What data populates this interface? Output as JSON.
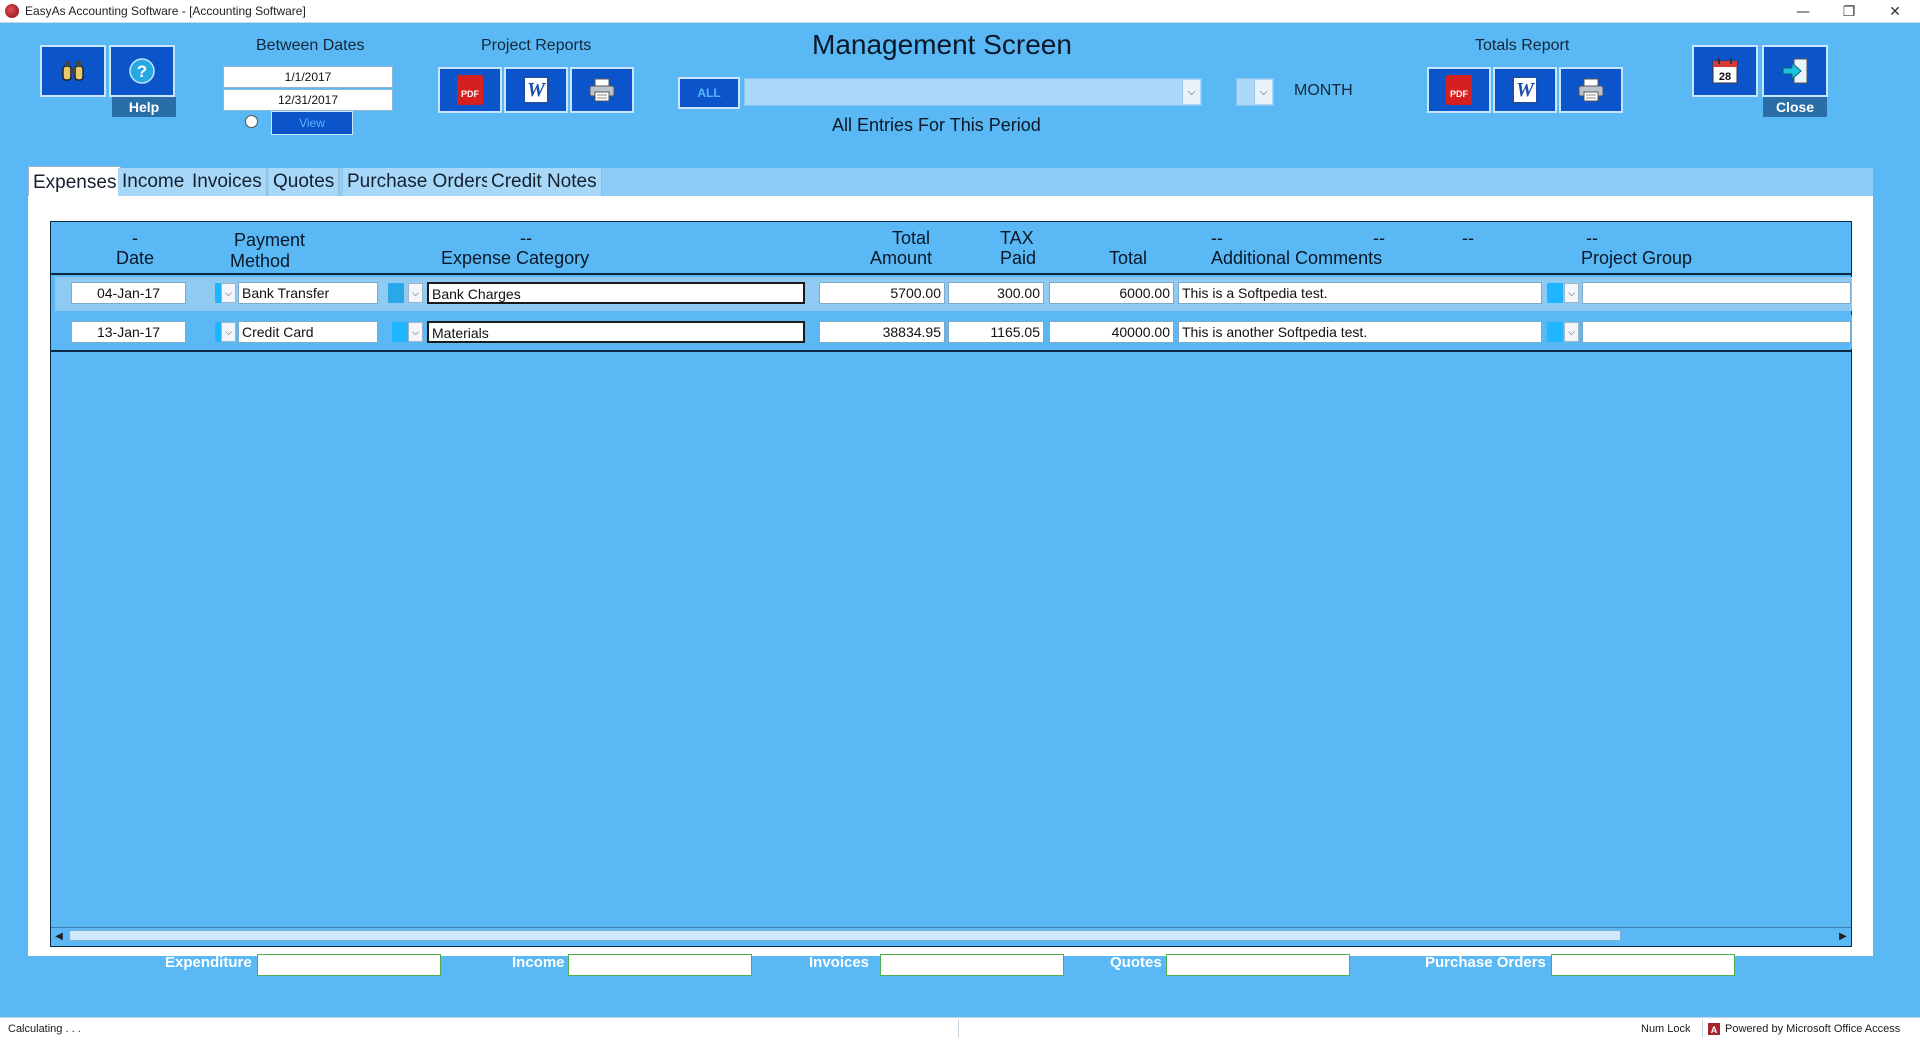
{
  "window": {
    "title": "EasyAs Accounting Software - [Accounting Software]",
    "minimize": "—",
    "restore": "❐",
    "close": "✕"
  },
  "toolbar": {
    "help_label": "Help",
    "close_label": "Close",
    "between_dates_label": "Between Dates",
    "date_from": "1/1/2017",
    "date_to": "12/31/2017",
    "view_label": "View",
    "project_reports_label": "Project Reports",
    "totals_report_label": "Totals Report",
    "all_label": "ALL",
    "period_label": "MONTH",
    "calendar_day": "28",
    "pdf_label": "PDF",
    "word_label": "W"
  },
  "header": {
    "title": "Management Screen",
    "subtitle": "All Entries For This Period"
  },
  "tabs": [
    {
      "label": "Expenses",
      "active": true
    },
    {
      "label": "Income",
      "active": false
    },
    {
      "label": "Invoices",
      "active": false
    },
    {
      "label": "Quotes",
      "active": false
    },
    {
      "label": "Purchase Orders",
      "active": false
    },
    {
      "label": "Credit Notes",
      "active": false
    }
  ],
  "columns": {
    "date_top": "-",
    "date": "Date",
    "payment_top": "Payment",
    "payment": "Method",
    "category_top": "--",
    "category": "Expense Category",
    "amount_top": "Total",
    "amount": "Amount",
    "tax_top": "TAX",
    "tax": "Paid",
    "total": "Total",
    "comments_top": "--",
    "comments": "Additional Comments",
    "extra1": "--",
    "extra2": "--",
    "project_top": "--",
    "project": "Project Group"
  },
  "rows": [
    {
      "date": "04-Jan-17",
      "method": "Bank Transfer",
      "category": "Bank Charges",
      "amount": "5700.00",
      "tax": "300.00",
      "total": "6000.00",
      "comments": "This is a Softpedia test.",
      "project": ""
    },
    {
      "date": "13-Jan-17",
      "method": "Credit Card",
      "category": "Materials",
      "amount": "38834.95",
      "tax": "1165.05",
      "total": "40000.00",
      "comments": "This is another Softpedia test.",
      "project": ""
    }
  ],
  "totals": {
    "expenditure_label": "Expenditure",
    "income_label": "Income",
    "invoices_label": "Invoices",
    "quotes_label": "Quotes",
    "purchase_orders_label": "Purchase Orders",
    "expenditure": "",
    "income": "",
    "invoices": "",
    "quotes": "",
    "purchase_orders": ""
  },
  "status": {
    "left": "Calculating . . .",
    "numlock": "Num Lock",
    "powered": "Powered by Microsoft Office Access"
  },
  "colors": {
    "background": "#5ab9f5",
    "button": "#0b54c9",
    "accent_swatch": "#1fb6ff"
  },
  "icons": [
    "binoculars-icon",
    "help-icon",
    "pdf-icon",
    "word-icon",
    "printer-icon",
    "calendar-icon",
    "exit-icon"
  ]
}
